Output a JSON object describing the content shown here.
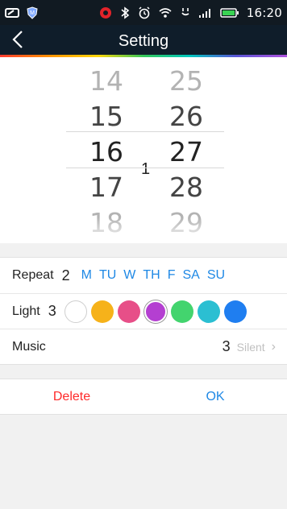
{
  "status_bar": {
    "time": "16:20",
    "icons": [
      "tablet-icon",
      "shield-app-icon",
      "music-app-icon",
      "bluetooth-icon",
      "alarm-icon",
      "wifi-icon",
      "network-icon",
      "signal-icon",
      "battery-icon"
    ]
  },
  "header": {
    "back_icon": "chevron-left-icon",
    "title": "Setting"
  },
  "picker": {
    "hours": [
      "14",
      "15",
      "16",
      "17",
      "18"
    ],
    "minutes": [
      "25",
      "26",
      "27",
      "28",
      "29"
    ],
    "separator": "1",
    "selected_hour": "16",
    "selected_minute": "27"
  },
  "repeat": {
    "label": "Repeat",
    "count": "2",
    "days": [
      "M",
      "TU",
      "W",
      "TH",
      "F",
      "SA",
      "SU"
    ]
  },
  "light": {
    "label": "Light",
    "count": "3",
    "colors": [
      "#ffffff",
      "#f6b21a",
      "#e74f88",
      "#b43fd1",
      "#43d46e",
      "#2bbfd2",
      "#1f7ef0"
    ],
    "selected_color_index": 3
  },
  "music": {
    "label": "Music",
    "count": "3",
    "value": "Silent",
    "chevron_icon": "chevron-right-icon"
  },
  "actions": {
    "delete": "Delete",
    "ok": "OK"
  },
  "colors": {
    "header_bg": "#0f1d2a",
    "accent_blue": "#1e88e5",
    "delete_red": "#ff2a2a"
  }
}
